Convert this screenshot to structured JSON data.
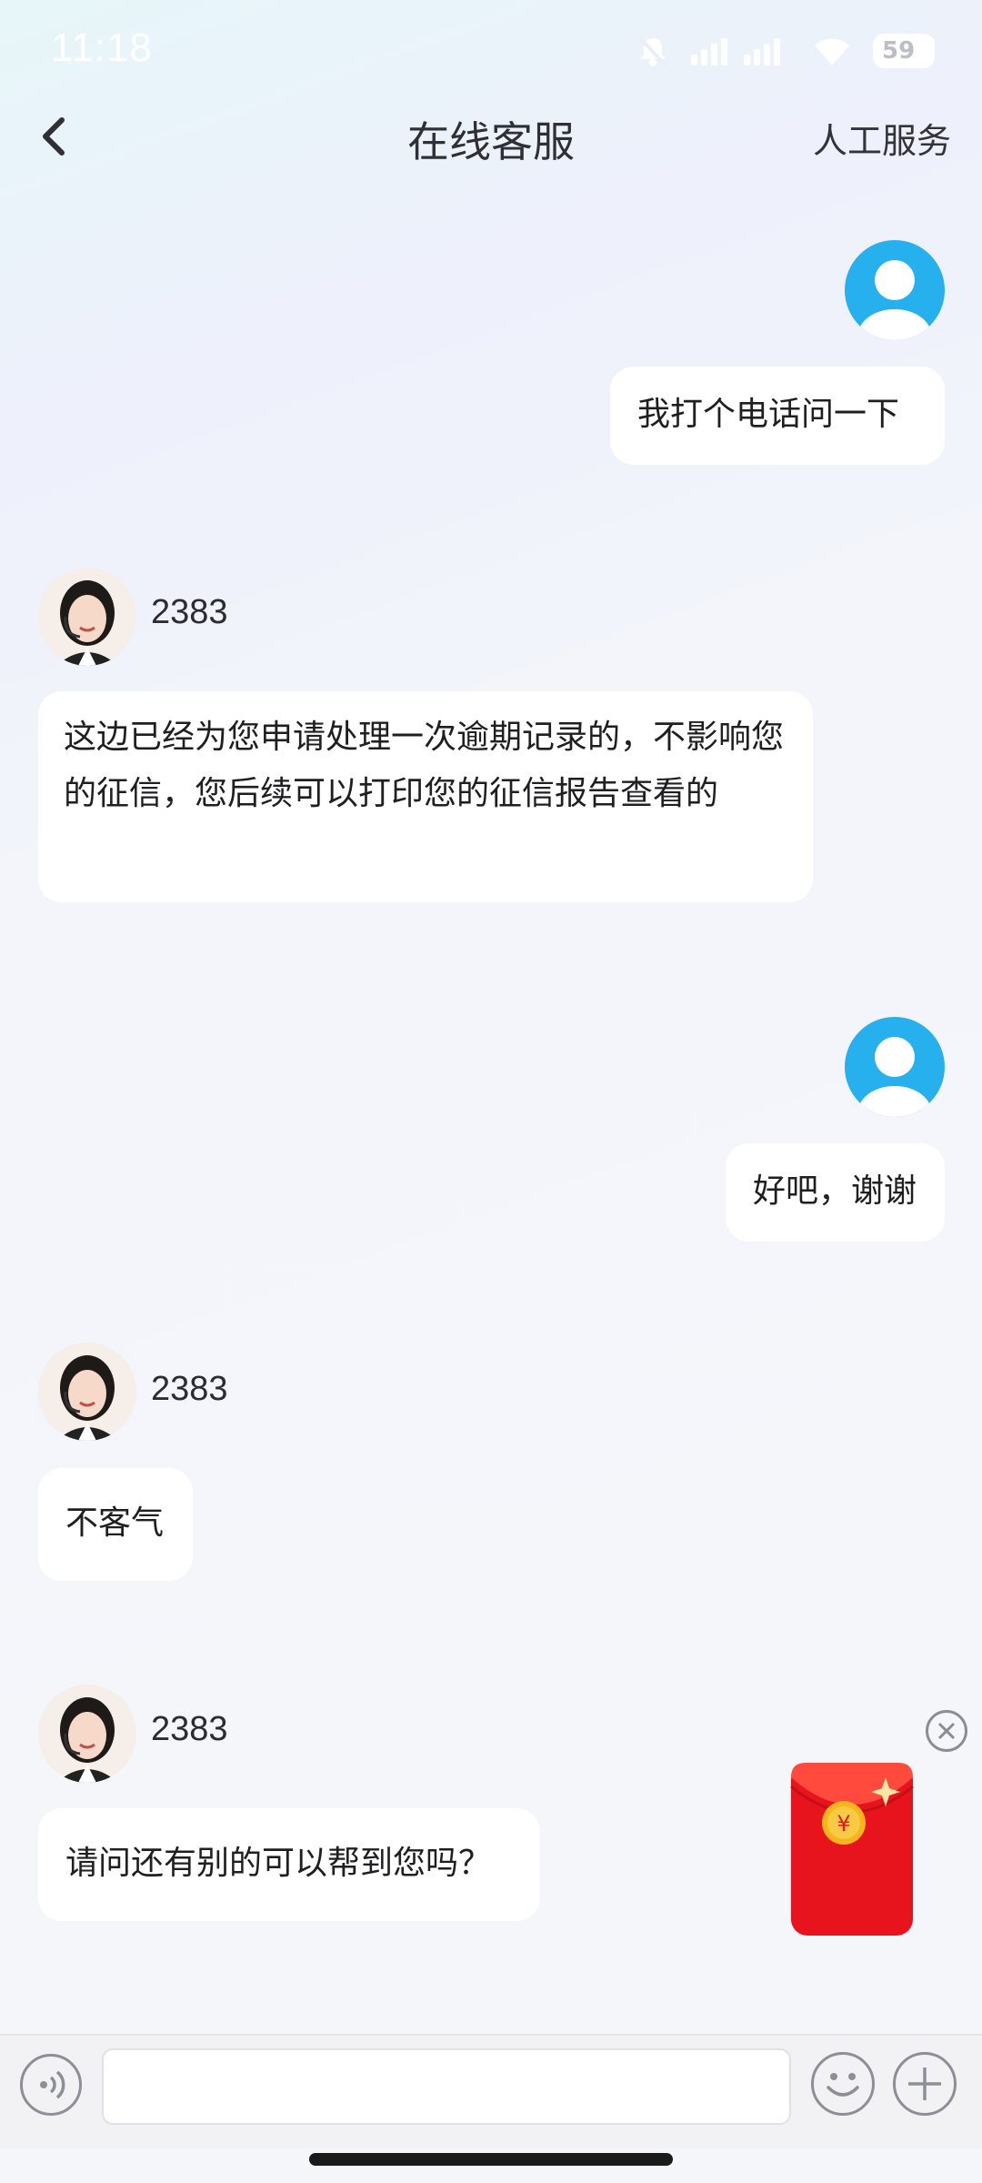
{
  "status_bar": {
    "time": "11:18",
    "battery": "59",
    "icons": [
      "bell-muted-icon",
      "signal-icon",
      "wifi-icon",
      "battery-icon"
    ]
  },
  "header": {
    "title": "在线客服",
    "right_action": "人工服务",
    "back_icon": "chevron-left-icon"
  },
  "messages": [
    {
      "sender": "user",
      "text": "我打个电话问一下"
    },
    {
      "sender": "agent",
      "name": "2383",
      "text": "这边已经为您申请处理一次逾期记录的，不影响您的征信，您后续可以打印您的征信报告查看的"
    },
    {
      "sender": "user",
      "text": "好吧，谢谢"
    },
    {
      "sender": "agent",
      "name": "2383",
      "text": "不客气"
    },
    {
      "sender": "agent",
      "name": "2383",
      "text": "请问还有别的可以帮到您吗？"
    }
  ],
  "floating": {
    "packet_symbol": "¥",
    "close_icon": "close-circle-icon"
  },
  "input_bar": {
    "placeholder": "",
    "voice_icon": "voice-icon",
    "emoji_icon": "emoji-icon",
    "plus_icon": "plus-circle-icon"
  },
  "colors": {
    "user_avatar": "#26b0ee",
    "bubble": "#ffffff",
    "packet_red": "#f4242b",
    "packet_gold": "#f6b51c"
  }
}
